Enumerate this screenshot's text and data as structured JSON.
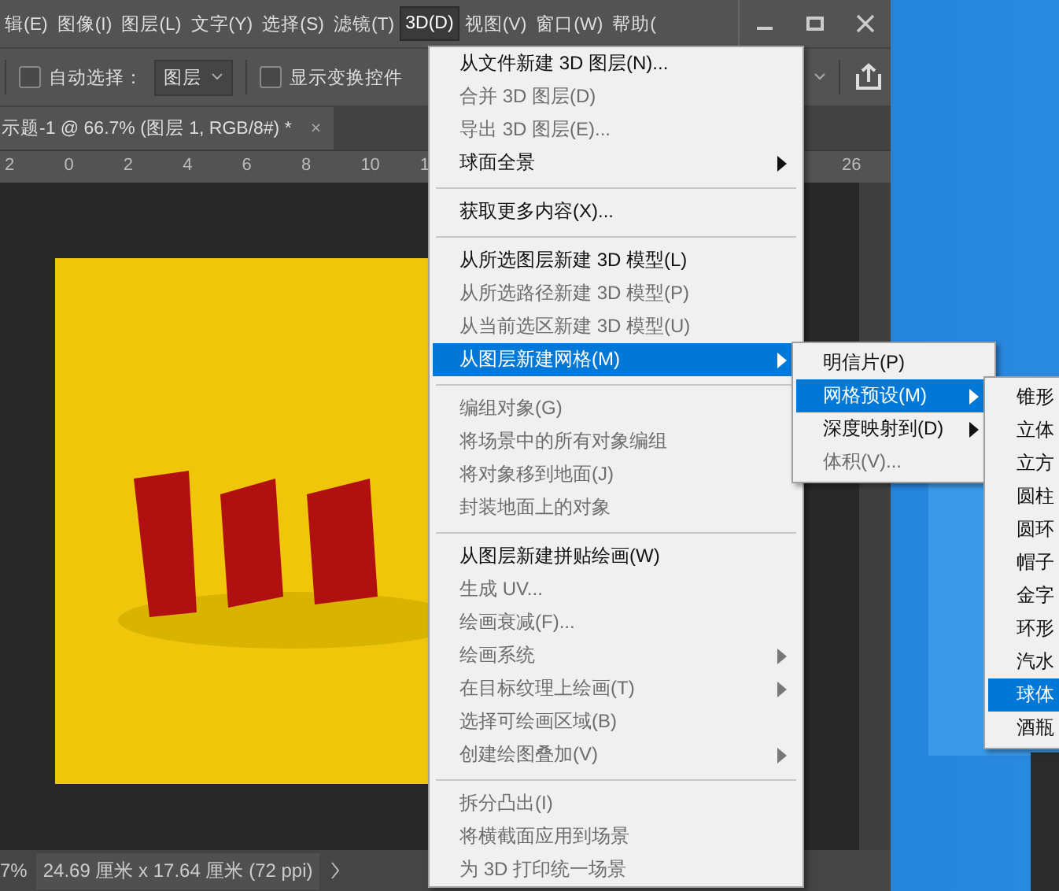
{
  "menu_bar": {
    "items": [
      {
        "label": "辑(E)",
        "selected": false
      },
      {
        "label": "图像(I)",
        "selected": false
      },
      {
        "label": "图层(L)",
        "selected": false
      },
      {
        "label": "文字(Y)",
        "selected": false
      },
      {
        "label": "选择(S)",
        "selected": false
      },
      {
        "label": "滤镜(T)",
        "selected": false
      },
      {
        "label": "3D(D)",
        "selected": true
      },
      {
        "label": "视图(V)",
        "selected": false
      },
      {
        "label": "窗口(W)",
        "selected": false
      },
      {
        "label": "帮助(",
        "selected": false
      }
    ]
  },
  "options_bar": {
    "auto_select": {
      "label": "自动选择：",
      "checked": false
    },
    "auto_select_target": "图层",
    "show_transform": {
      "label": "显示变换控件",
      "checked": false
    }
  },
  "document_tab": {
    "title": "示题-1 @ 66.7% (图层 1, RGB/8#) *",
    "close": "×"
  },
  "ruler": {
    "labels": [
      "2",
      "0",
      "2",
      "4",
      "6",
      "8",
      "10",
      "1",
      "26"
    ]
  },
  "status_bar": {
    "zoom": "7%",
    "doc_info": "24.69 厘米 x 17.64 厘米 (72 ppi)"
  },
  "menu_3d": {
    "items": [
      {
        "kind": "item",
        "label": "从文件新建 3D 图层(N)...",
        "disabled": false,
        "selected": false,
        "submenu": false
      },
      {
        "kind": "item",
        "label": "合并 3D 图层(D)",
        "disabled": true,
        "selected": false,
        "submenu": false
      },
      {
        "kind": "item",
        "label": "导出 3D 图层(E)...",
        "disabled": true,
        "selected": false,
        "submenu": false
      },
      {
        "kind": "item",
        "label": "球面全景",
        "disabled": false,
        "selected": false,
        "submenu": true
      },
      {
        "kind": "separator"
      },
      {
        "kind": "item",
        "label": "获取更多内容(X)...",
        "disabled": false,
        "selected": false,
        "submenu": false
      },
      {
        "kind": "separator"
      },
      {
        "kind": "item",
        "label": "从所选图层新建 3D 模型(L)",
        "disabled": false,
        "selected": false,
        "submenu": false
      },
      {
        "kind": "item",
        "label": "从所选路径新建 3D 模型(P)",
        "disabled": true,
        "selected": false,
        "submenu": false
      },
      {
        "kind": "item",
        "label": "从当前选区新建 3D 模型(U)",
        "disabled": true,
        "selected": false,
        "submenu": false
      },
      {
        "kind": "item",
        "label": "从图层新建网格(M)",
        "disabled": false,
        "selected": true,
        "submenu": true
      },
      {
        "kind": "separator"
      },
      {
        "kind": "item",
        "label": "编组对象(G)",
        "disabled": true,
        "selected": false,
        "submenu": false
      },
      {
        "kind": "item",
        "label": "将场景中的所有对象编组",
        "disabled": true,
        "selected": false,
        "submenu": false
      },
      {
        "kind": "item",
        "label": "将对象移到地面(J)",
        "disabled": true,
        "selected": false,
        "submenu": false
      },
      {
        "kind": "item",
        "label": "封装地面上的对象",
        "disabled": true,
        "selected": false,
        "submenu": false
      },
      {
        "kind": "separator"
      },
      {
        "kind": "item",
        "label": "从图层新建拼贴绘画(W)",
        "disabled": false,
        "selected": false,
        "submenu": false
      },
      {
        "kind": "item",
        "label": "生成 UV...",
        "disabled": true,
        "selected": false,
        "submenu": false
      },
      {
        "kind": "item",
        "label": "绘画衰减(F)...",
        "disabled": true,
        "selected": false,
        "submenu": false
      },
      {
        "kind": "item",
        "label": "绘画系统",
        "disabled": true,
        "selected": false,
        "submenu": true
      },
      {
        "kind": "item",
        "label": "在目标纹理上绘画(T)",
        "disabled": true,
        "selected": false,
        "submenu": true
      },
      {
        "kind": "item",
        "label": "选择可绘画区域(B)",
        "disabled": true,
        "selected": false,
        "submenu": false
      },
      {
        "kind": "item",
        "label": "创建绘图叠加(V)",
        "disabled": true,
        "selected": false,
        "submenu": true
      },
      {
        "kind": "separator"
      },
      {
        "kind": "item",
        "label": "拆分凸出(I)",
        "disabled": true,
        "selected": false,
        "submenu": false
      },
      {
        "kind": "item",
        "label": "将横截面应用到场景",
        "disabled": true,
        "selected": false,
        "submenu": false
      },
      {
        "kind": "item",
        "label": "为 3D 打印统一场景",
        "disabled": true,
        "selected": false,
        "submenu": false
      }
    ]
  },
  "mesh_submenu": {
    "items": [
      {
        "kind": "item",
        "label": "明信片(P)",
        "disabled": false,
        "selected": false,
        "submenu": false
      },
      {
        "kind": "item",
        "label": "网格预设(M)",
        "disabled": false,
        "selected": true,
        "submenu": true
      },
      {
        "kind": "item",
        "label": "深度映射到(D)",
        "disabled": false,
        "selected": false,
        "submenu": true
      },
      {
        "kind": "item",
        "label": "体积(V)...",
        "disabled": true,
        "selected": false,
        "submenu": false
      }
    ]
  },
  "preset_submenu": {
    "items": [
      {
        "kind": "item",
        "label": "锥形",
        "disabled": false,
        "selected": false
      },
      {
        "kind": "item",
        "label": "立体",
        "disabled": false,
        "selected": false
      },
      {
        "kind": "item",
        "label": "立方",
        "disabled": false,
        "selected": false
      },
      {
        "kind": "item",
        "label": "圆柱",
        "disabled": false,
        "selected": false
      },
      {
        "kind": "item",
        "label": "圆环",
        "disabled": false,
        "selected": false
      },
      {
        "kind": "item",
        "label": "帽子",
        "disabled": false,
        "selected": false
      },
      {
        "kind": "item",
        "label": "金字",
        "disabled": false,
        "selected": false
      },
      {
        "kind": "item",
        "label": "环形",
        "disabled": false,
        "selected": false
      },
      {
        "kind": "item",
        "label": "汽水",
        "disabled": false,
        "selected": false
      },
      {
        "kind": "item",
        "label": "球体",
        "disabled": false,
        "selected": true
      },
      {
        "kind": "item",
        "label": "酒瓶",
        "disabled": false,
        "selected": false
      }
    ]
  }
}
